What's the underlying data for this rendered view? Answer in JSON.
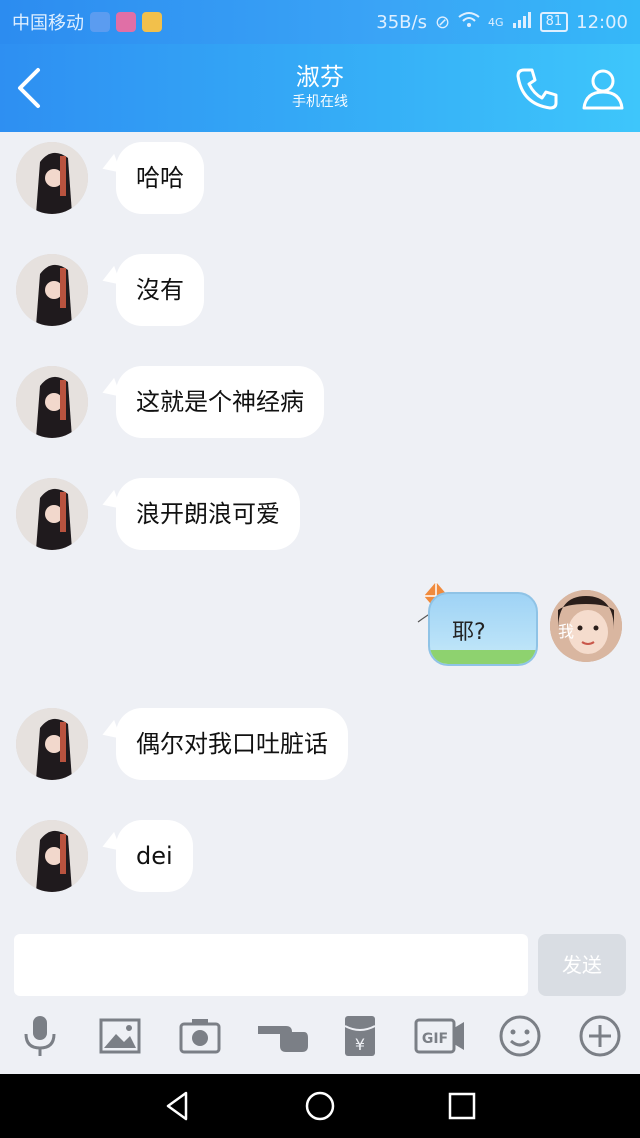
{
  "status_bar": {
    "carrier": "中国移动",
    "speed": "35B/s",
    "network": "4G",
    "battery": "81",
    "time": "12:00"
  },
  "header": {
    "title": "淑芬",
    "subtitle": "手机在线"
  },
  "messages": [
    {
      "sender": "other",
      "text": "哈哈"
    },
    {
      "sender": "other",
      "text": "沒有"
    },
    {
      "sender": "other",
      "text": "这就是个神经病"
    },
    {
      "sender": "other",
      "text": "浪开朗浪可爱"
    },
    {
      "sender": "me",
      "text": "耶?",
      "avatar_label": "我"
    },
    {
      "sender": "other",
      "text": "偶尔对我口吐脏话"
    },
    {
      "sender": "other",
      "text": "dei"
    }
  ],
  "input": {
    "placeholder": "",
    "send_label": "发送"
  },
  "toolbar": {
    "icons": [
      "microphone-icon",
      "image-icon",
      "camera-icon",
      "poke-icon",
      "red-packet-icon",
      "gif-icon",
      "emoji-icon",
      "plus-icon"
    ]
  },
  "colors": {
    "header_gradient_start": "#2e8ff2",
    "header_gradient_end": "#3ec6fb",
    "chat_background": "#eef0f5",
    "bubble_background": "#ffffff",
    "icon_gray": "#7b7f86"
  }
}
